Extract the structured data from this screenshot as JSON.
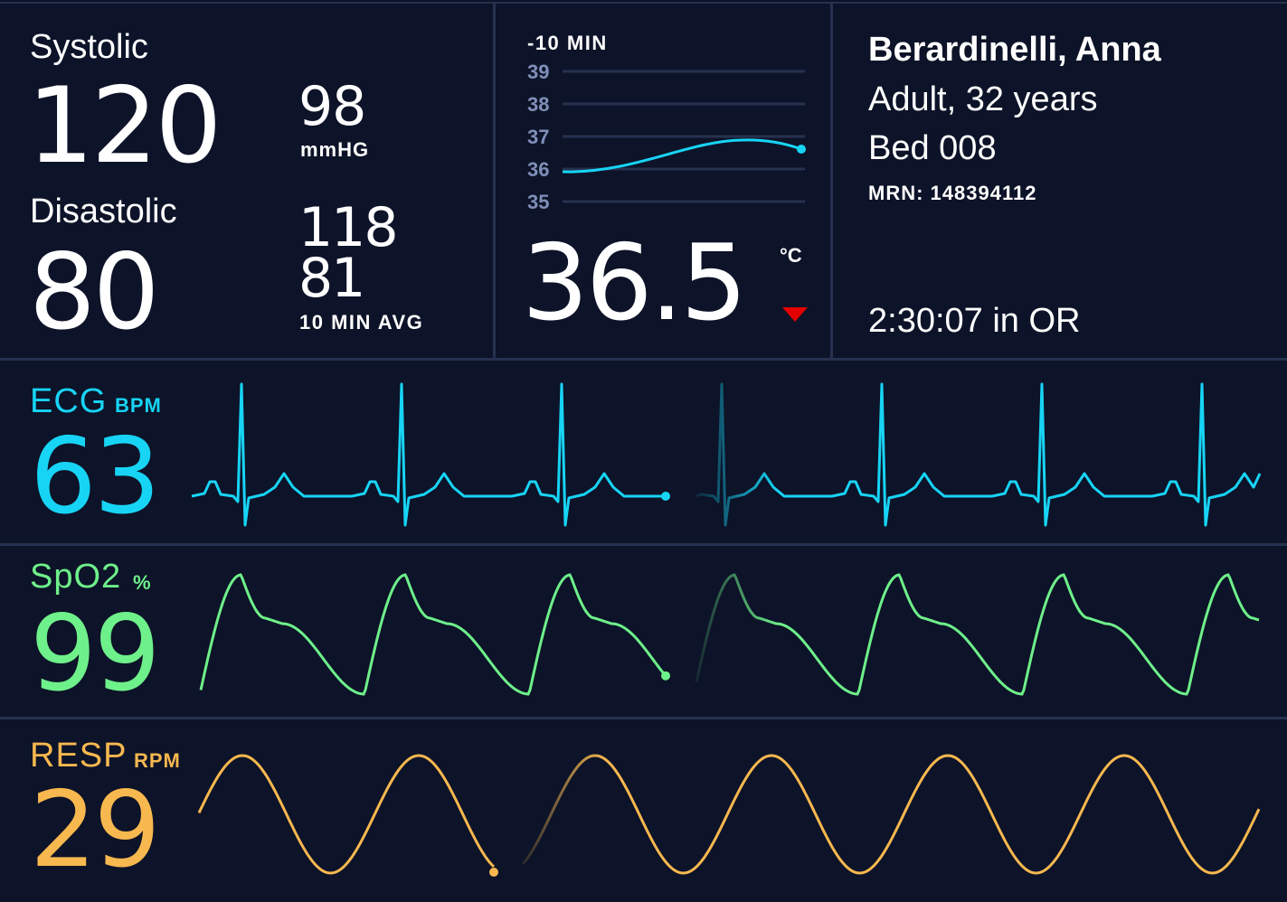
{
  "blood_pressure": {
    "systolic_label": "Systolic",
    "systolic_value": "120",
    "diastolic_label": "Disastolic",
    "diastolic_value": "80",
    "current_value": "98",
    "current_unit": "mmHG",
    "avg_systolic": "118",
    "avg_diastolic": "81",
    "avg_label": "10 MIN AVG"
  },
  "temperature": {
    "range_label": "-10 MIN",
    "y_ticks": [
      "39",
      "38",
      "37",
      "36",
      "35"
    ],
    "value": "36.5",
    "unit": "°C",
    "trend": "down",
    "trend_color": "#e30000"
  },
  "patient": {
    "name": "Berardinelli, Anna",
    "age_line": "Adult, 32 years",
    "bed": "Bed 008",
    "mrn": "MRN: 148394112",
    "or_time": "2:30:07 in OR"
  },
  "ecg": {
    "label": "ECG",
    "unit": "BPM",
    "value": "63",
    "color": "#17d4f5"
  },
  "spo2": {
    "label": "SpO2",
    "unit": "%",
    "value": "99",
    "color": "#6ef08a"
  },
  "resp": {
    "label": "RESP",
    "unit": "RPM",
    "value": "29",
    "color": "#f7b84f"
  },
  "colors": {
    "background": "#0d1328",
    "divider": "#26314f",
    "grid_tick": "#7f8fb8"
  }
}
